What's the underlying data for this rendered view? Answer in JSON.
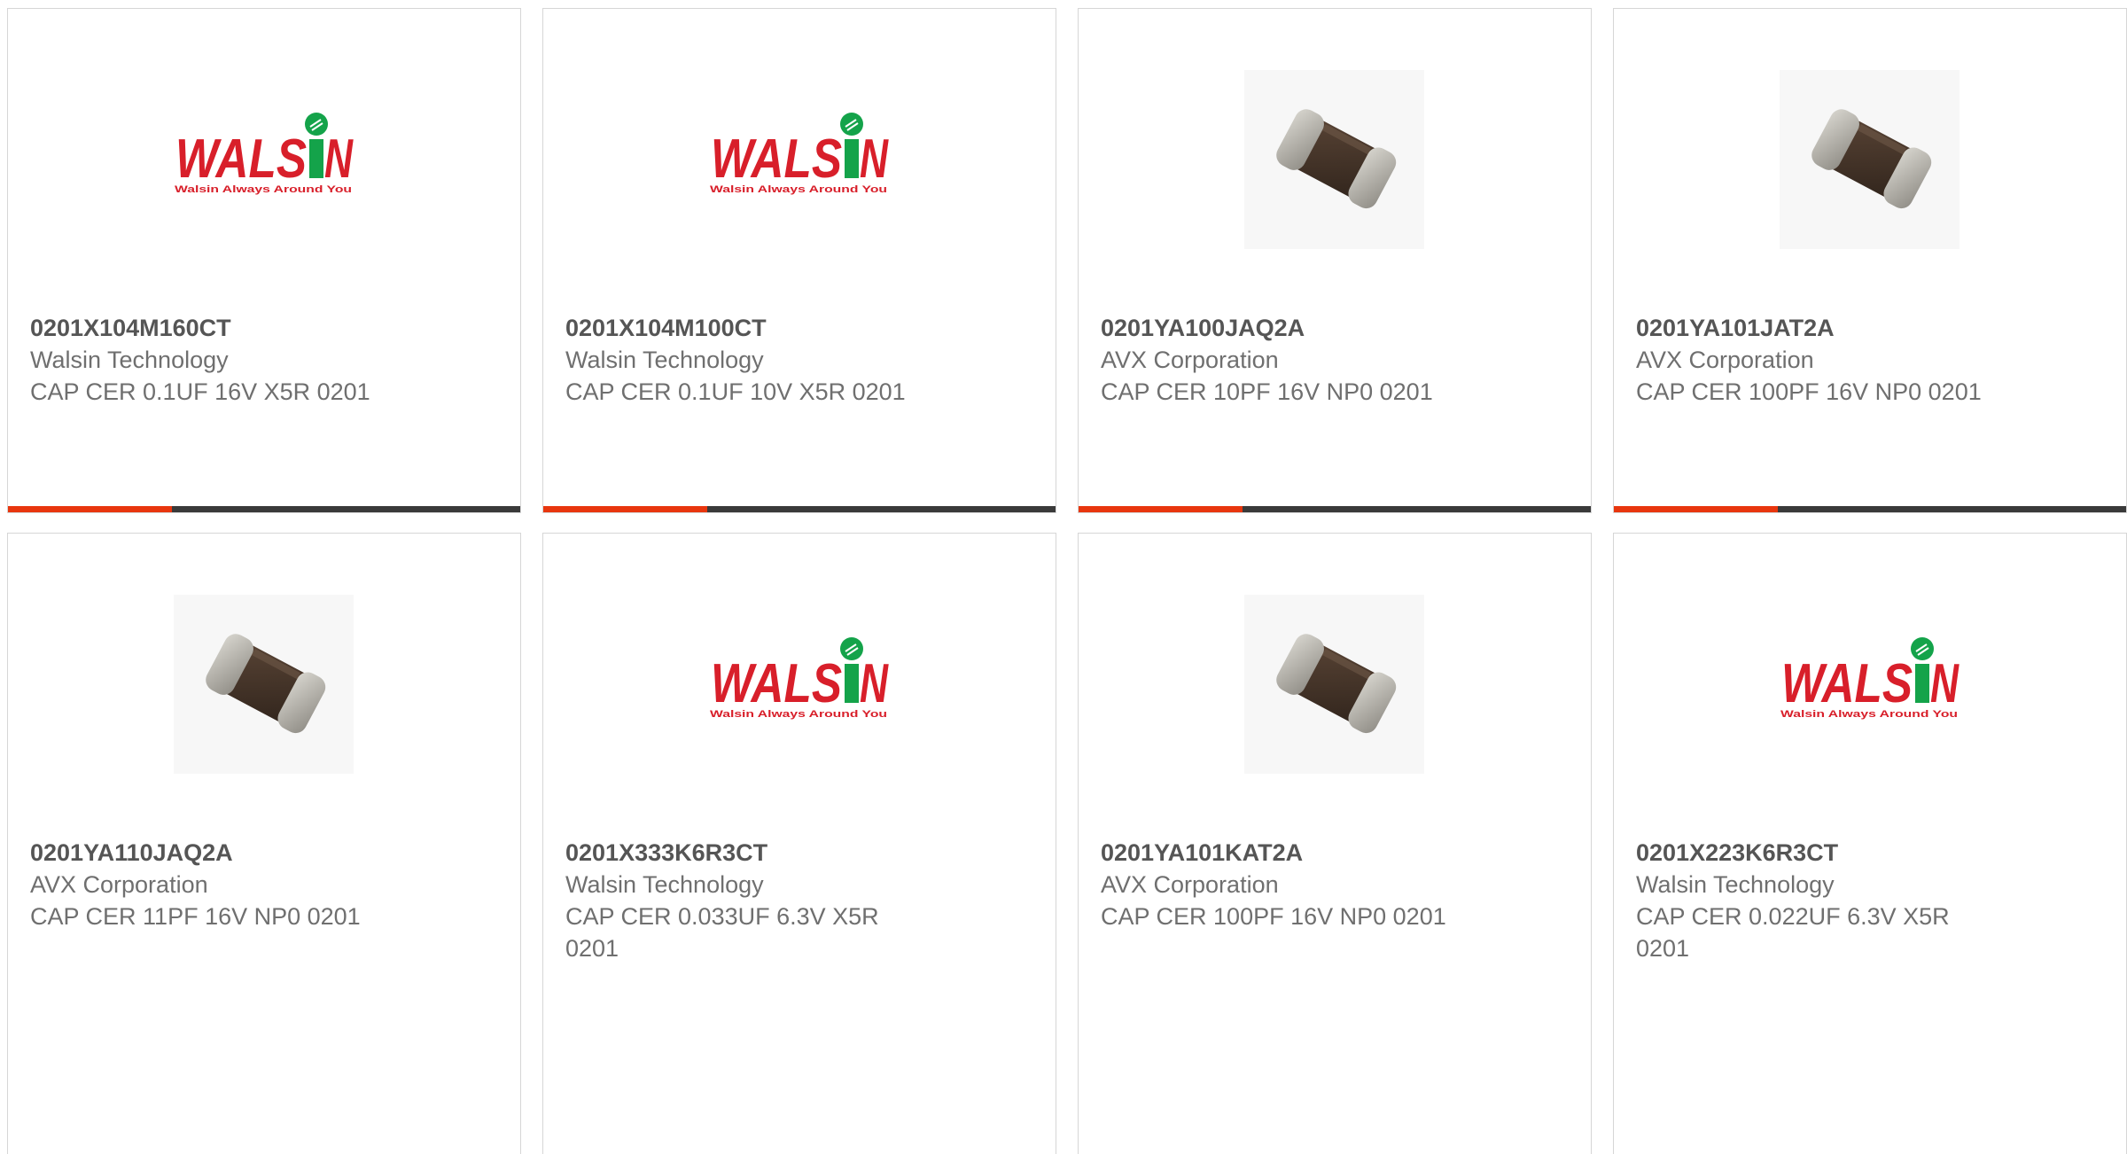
{
  "colors": {
    "accent": "#e8360e",
    "bar_dark": "#3a3a3a",
    "walsin_red": "#d81f2a",
    "walsin_green": "#14a34a"
  },
  "products": [
    {
      "part_number": "0201X104M160CT",
      "manufacturer": "Walsin Technology",
      "description": "CAP CER 0.1UF 16V X5R 0201",
      "image": "walsin-logo",
      "logo_tagline": "Walsin Always Around You",
      "has_progress_bar": true,
      "bar_fraction": 0.32
    },
    {
      "part_number": "0201X104M100CT",
      "manufacturer": "Walsin Technology",
      "description": "CAP CER 0.1UF 10V X5R 0201",
      "image": "walsin-logo",
      "logo_tagline": "Walsin Always Around You",
      "has_progress_bar": true,
      "bar_fraction": 0.32
    },
    {
      "part_number": "0201YA100JAQ2A",
      "manufacturer": "AVX Corporation",
      "description": "CAP CER 10PF 16V NP0 0201",
      "image": "ceramic-chip-capacitor",
      "has_progress_bar": true,
      "bar_fraction": 0.32
    },
    {
      "part_number": "0201YA101JAT2A",
      "manufacturer": "AVX Corporation",
      "description": "CAP CER 100PF 16V NP0 0201",
      "image": "ceramic-chip-capacitor",
      "has_progress_bar": true,
      "bar_fraction": 0.32
    },
    {
      "part_number": "0201YA110JAQ2A",
      "manufacturer": "AVX Corporation",
      "description": "CAP CER 11PF 16V NP0 0201",
      "image": "ceramic-chip-capacitor",
      "has_progress_bar": false
    },
    {
      "part_number": "0201X333K6R3CT",
      "manufacturer": "Walsin Technology",
      "description": "CAP CER 0.033UF 6.3V X5R 0201",
      "image": "walsin-logo",
      "logo_tagline": "Walsin Always Around You",
      "has_progress_bar": false
    },
    {
      "part_number": "0201YA101KAT2A",
      "manufacturer": "AVX Corporation",
      "description": "CAP CER 100PF 16V NP0 0201",
      "image": "ceramic-chip-capacitor",
      "has_progress_bar": false
    },
    {
      "part_number": "0201X223K6R3CT",
      "manufacturer": "Walsin Technology",
      "description": "CAP CER 0.022UF 6.3V X5R 0201",
      "image": "walsin-logo",
      "logo_tagline": "Walsin Always Around You",
      "has_progress_bar": false
    }
  ]
}
